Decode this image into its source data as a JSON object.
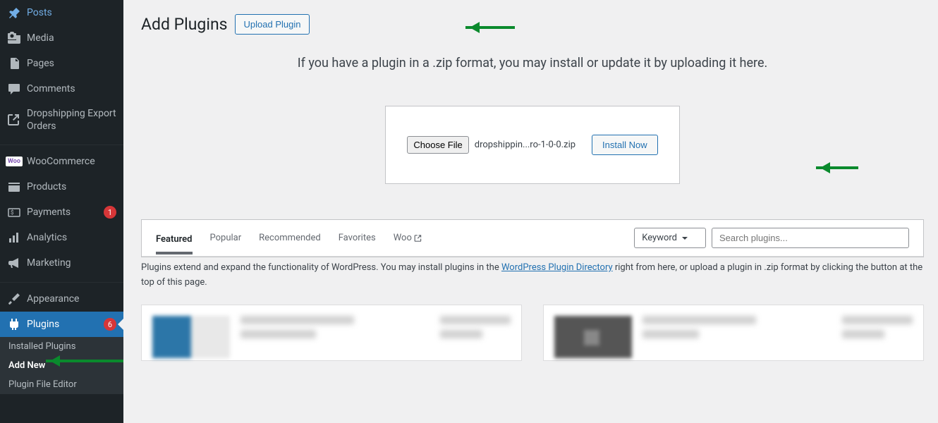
{
  "sidebar": {
    "items": [
      {
        "label": "Posts",
        "icon": "pin"
      },
      {
        "label": "Media",
        "icon": "media"
      },
      {
        "label": "Pages",
        "icon": "page"
      },
      {
        "label": "Comments",
        "icon": "comment"
      },
      {
        "label": "Dropshipping Export Orders",
        "icon": "external"
      },
      {
        "label": "WooCommerce",
        "icon": "woo"
      },
      {
        "label": "Products",
        "icon": "products"
      },
      {
        "label": "Payments",
        "icon": "payments",
        "badge": "1"
      },
      {
        "label": "Analytics",
        "icon": "analytics"
      },
      {
        "label": "Marketing",
        "icon": "marketing"
      },
      {
        "label": "Appearance",
        "icon": "appearance"
      },
      {
        "label": "Plugins",
        "icon": "plugin",
        "badge": "6",
        "active": true
      }
    ],
    "submenu": [
      {
        "label": "Installed Plugins"
      },
      {
        "label": "Add New",
        "active": true
      },
      {
        "label": "Plugin File Editor"
      }
    ]
  },
  "header": {
    "title": "Add Plugins",
    "upload_button": "Upload Plugin"
  },
  "upload": {
    "message": "If you have a plugin in a .zip format, you may install or update it by uploading it here.",
    "choose_file": "Choose File",
    "filename": "dropshippin...ro-1-0-0.zip",
    "install_button": "Install Now"
  },
  "browser": {
    "tabs": [
      {
        "label": "Featured",
        "active": true
      },
      {
        "label": "Popular"
      },
      {
        "label": "Recommended"
      },
      {
        "label": "Favorites"
      },
      {
        "label": "Woo",
        "external": true
      }
    ],
    "keyword_label": "Keyword",
    "search_placeholder": "Search plugins...",
    "description_pre": "Plugins extend and expand the functionality of WordPress. You may install plugins in the ",
    "description_link": "WordPress Plugin Directory",
    "description_post": " right from here, or upload a plugin in .zip format by clicking the button at the top of this page."
  }
}
